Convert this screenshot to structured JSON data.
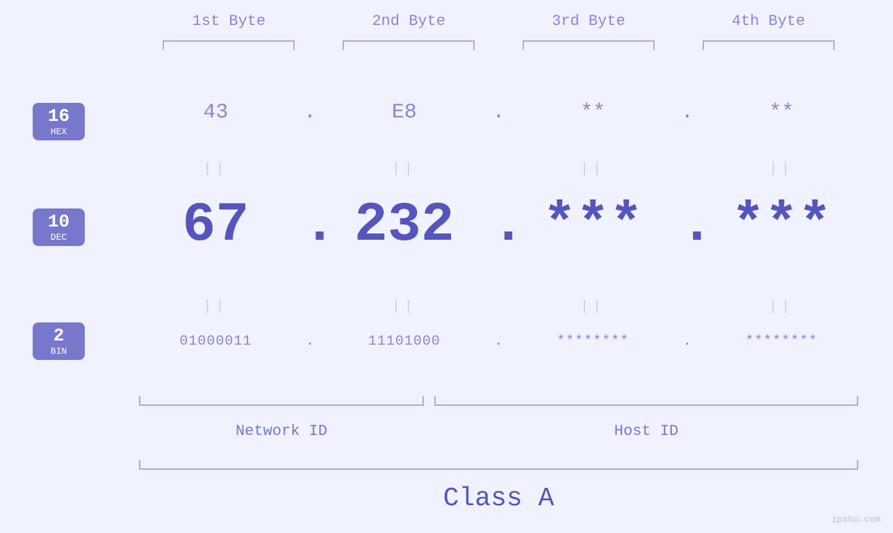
{
  "headers": {
    "byte1": "1st Byte",
    "byte2": "2nd Byte",
    "byte3": "3rd Byte",
    "byte4": "4th Byte"
  },
  "badges": {
    "hex": {
      "num": "16",
      "label": "HEX"
    },
    "dec": {
      "num": "10",
      "label": "DEC"
    },
    "bin": {
      "num": "2",
      "label": "BIN"
    }
  },
  "values": {
    "hex": {
      "b1": "43",
      "b2": "E8",
      "b3": "**",
      "b4": "**",
      "d1": ".",
      "d2": ".",
      "d3": ".",
      "d4": ""
    },
    "dec": {
      "b1": "67",
      "b2": "232",
      "b3": "***",
      "b4": "***",
      "d1": ".",
      "d2": ".",
      "d3": ".",
      "d4": ""
    },
    "bin": {
      "b1": "01000011",
      "b2": "11101000",
      "b3": "********",
      "b4": "********",
      "d1": ".",
      "d2": ".",
      "d3": ".",
      "d4": ""
    }
  },
  "equals": "||",
  "labels": {
    "network": "Network ID",
    "host": "Host ID",
    "class": "Class A"
  },
  "watermark": "ipshu.com",
  "colors": {
    "accent": "#5555bb",
    "light": "#8888cc",
    "badge": "#7777cc",
    "bracket": "#aaaadd",
    "eq": "#ccccee"
  }
}
